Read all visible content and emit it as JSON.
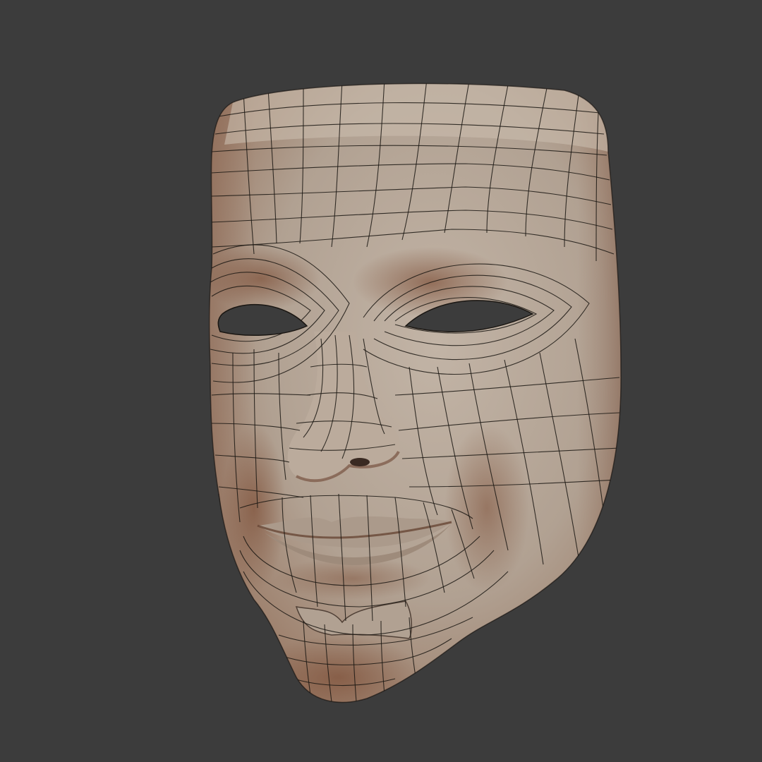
{
  "scene": {
    "background_color": "#3c3c3c",
    "subject": "mask-mesh",
    "surface_color": "#b3a496",
    "shadow_color": "#7a4a32",
    "wire_color": "#1a1612",
    "eye_hole_color": "#3c3c3c"
  }
}
